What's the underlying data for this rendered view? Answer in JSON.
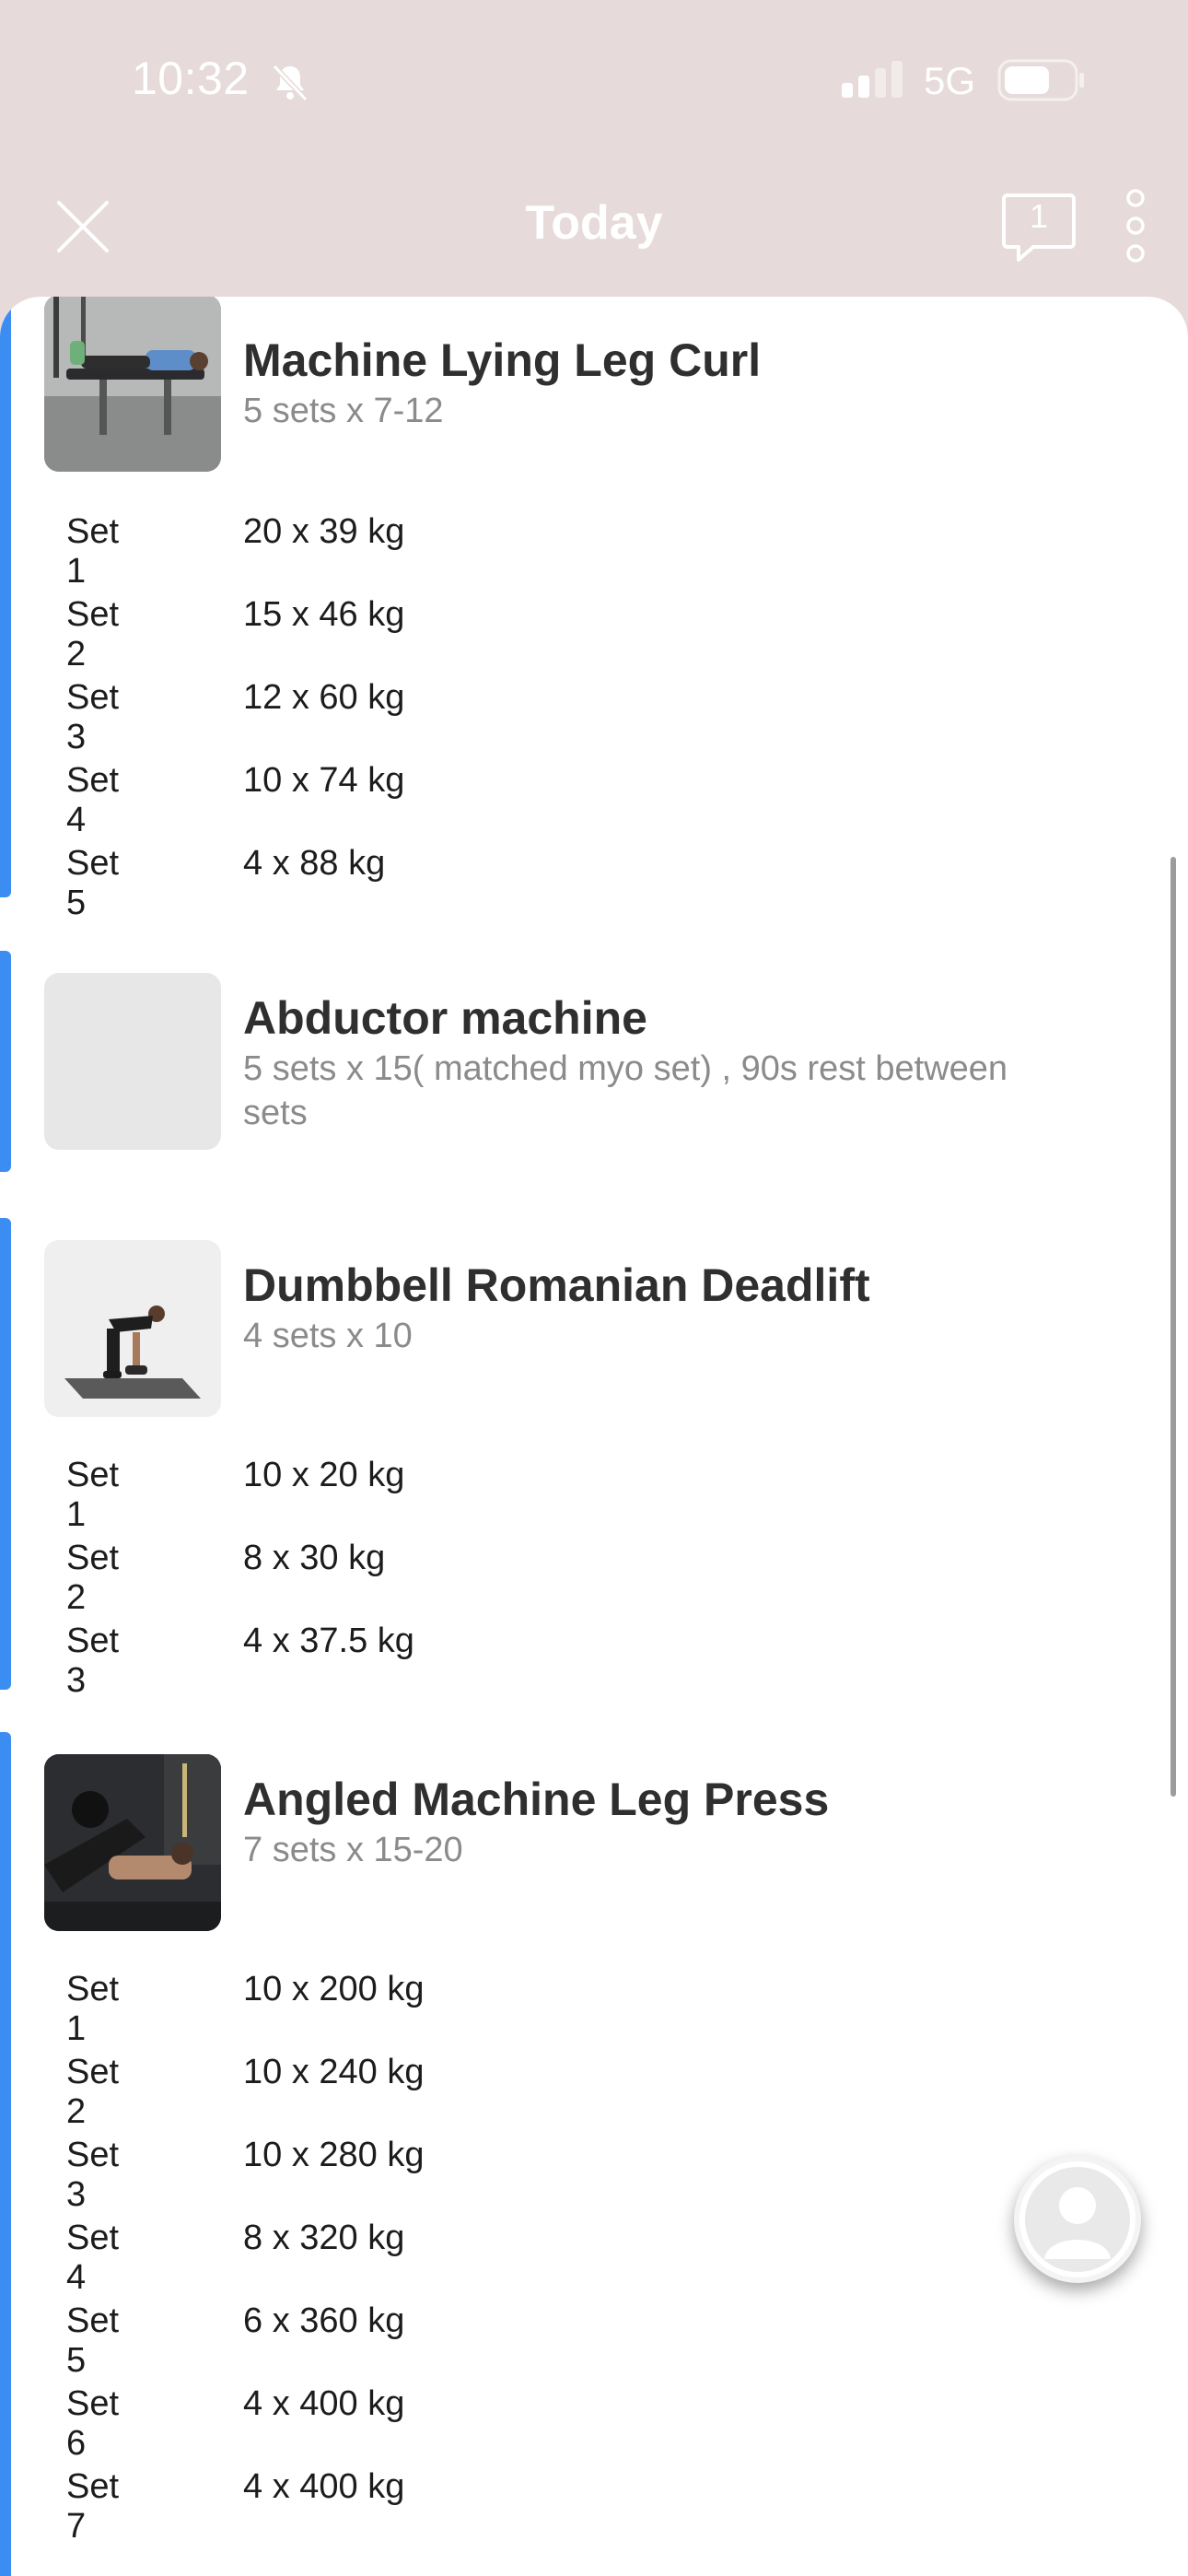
{
  "status_bar": {
    "time": "10:32",
    "network": "5G"
  },
  "nav": {
    "title": "Today",
    "chat_count": "1"
  },
  "exercises": [
    {
      "name": "Machine Lying Leg Curl",
      "subtitle": "5 sets x 7-12",
      "sets": [
        {
          "label": "Set 1",
          "value": "20 x 39 kg"
        },
        {
          "label": "Set 2",
          "value": "15 x 46 kg"
        },
        {
          "label": "Set 3",
          "value": "12 x 60 kg"
        },
        {
          "label": "Set 4",
          "value": "10 x 74 kg"
        },
        {
          "label": "Set 5",
          "value": "4 x 88 kg"
        }
      ]
    },
    {
      "name": "Abductor machine",
      "subtitle": "5 sets x 15( matched myo set) , 90s rest between sets",
      "sets": []
    },
    {
      "name": "Dumbbell Romanian Deadlift",
      "subtitle": "4 sets x 10",
      "sets": [
        {
          "label": "Set 1",
          "value": "10 x 20 kg"
        },
        {
          "label": "Set 2",
          "value": "8 x 30 kg"
        },
        {
          "label": "Set 3",
          "value": "4 x 37.5 kg"
        }
      ]
    },
    {
      "name": "Angled Machine Leg Press",
      "subtitle": "7 sets x 15-20",
      "sets": [
        {
          "label": "Set 1",
          "value": "10 x 200 kg"
        },
        {
          "label": "Set 2",
          "value": "10 x 240 kg"
        },
        {
          "label": "Set 3",
          "value": "10 x 280 kg"
        },
        {
          "label": "Set 4",
          "value": "8 x 320 kg"
        },
        {
          "label": "Set 5",
          "value": "6 x 360 kg"
        },
        {
          "label": "Set 6",
          "value": "4 x 400 kg"
        },
        {
          "label": "Set 7",
          "value": "4 x 400 kg"
        }
      ]
    }
  ],
  "icons": {
    "close": "close-icon",
    "chat": "chat-bubble-icon",
    "more": "more-vertical-icon",
    "bell": "bell-slash-icon",
    "avatar": "user-avatar-icon"
  },
  "colors": {
    "accent": "#3b8df2",
    "header_bg": "#e6dada"
  }
}
